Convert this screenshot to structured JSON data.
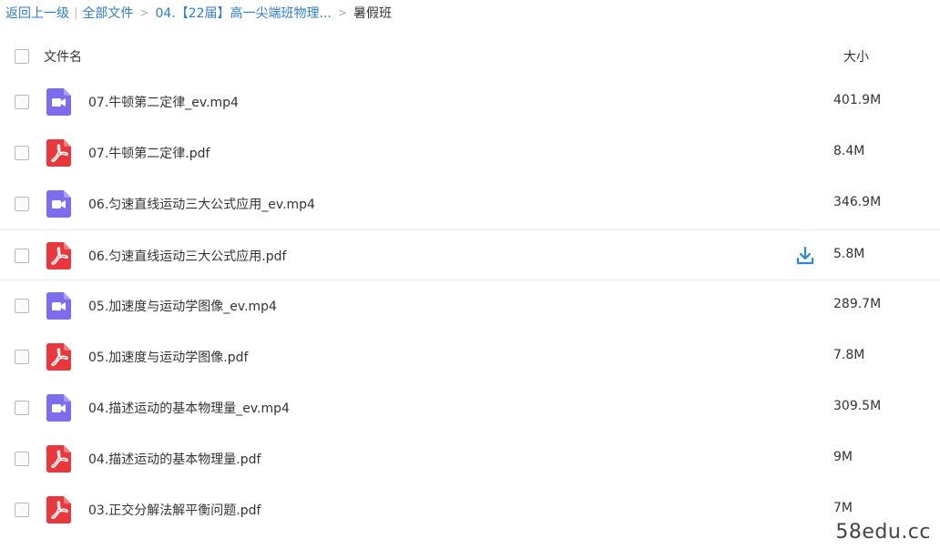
{
  "breadcrumb": {
    "back": "返回上一级",
    "sep": "|",
    "all_files": "全部文件",
    "arrow": ">",
    "folder": "04.【22届】高一尖端班物理...",
    "current": "暑假班"
  },
  "header": {
    "name_label": "文件名",
    "size_label": "大小"
  },
  "files": [
    {
      "name": "07.牛顿第二定律_ev.mp4",
      "size": "401.9M",
      "type": "video"
    },
    {
      "name": "07.牛顿第二定律.pdf",
      "size": "8.4M",
      "type": "pdf"
    },
    {
      "name": "06.匀速直线运动三大公式应用_ev.mp4",
      "size": "346.9M",
      "type": "video"
    },
    {
      "name": "06.匀速直线运动三大公式应用.pdf",
      "size": "5.8M",
      "type": "pdf",
      "hovered": true
    },
    {
      "name": "05.加速度与运动学图像_ev.mp4",
      "size": "289.7M",
      "type": "video"
    },
    {
      "name": "05.加速度与运动学图像.pdf",
      "size": "7.8M",
      "type": "pdf"
    },
    {
      "name": "04.描述运动的基本物理量_ev.mp4",
      "size": "309.5M",
      "type": "video"
    },
    {
      "name": "04.描述运动的基本物理量.pdf",
      "size": "9M",
      "type": "pdf"
    },
    {
      "name": "03.正交分解法解平衡问题.pdf",
      "size": "7M",
      "type": "pdf"
    }
  ],
  "colors": {
    "link": "#2e7dd1",
    "video_icon": "#7b6cf0",
    "pdf_icon": "#e8383d",
    "download_icon": "#2e86de",
    "hover_border": "#d8eef6"
  },
  "watermark": "58edu.cc"
}
